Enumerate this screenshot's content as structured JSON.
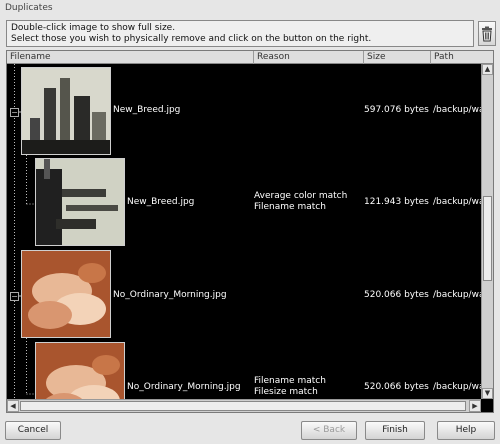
{
  "window": {
    "title": "Duplicates"
  },
  "info": {
    "line1": "Double-click image to show full size.",
    "line2": "Select those you wish to physically remove and click on the button on the right."
  },
  "trash_button": {
    "icon": "trash-icon"
  },
  "columns": [
    "Filename",
    "Reason",
    "Size",
    "Path"
  ],
  "rows": [
    {
      "filename": "New_Breed.jpg",
      "reason": [
        "",
        ""
      ],
      "size": "597.076 bytes",
      "path": "/backup/wall"
    },
    {
      "filename": "New_Breed.jpg",
      "reason": [
        "Average color match",
        "Filename match"
      ],
      "size": "121.943 bytes",
      "path": "/backup/wall"
    },
    {
      "filename": "No_Ordinary_Morning.jpg",
      "reason": [
        "",
        ""
      ],
      "size": "520.066 bytes",
      "path": "/backup/wall"
    },
    {
      "filename": "No_Ordinary_Morning.jpg",
      "reason": [
        "Filename match",
        "Filesize match"
      ],
      "size": "520.066 bytes",
      "path": "/backup/wall"
    }
  ],
  "buttons": {
    "cancel": "Cancel",
    "back": "< Back",
    "finish": "Finish",
    "help": "Help"
  }
}
